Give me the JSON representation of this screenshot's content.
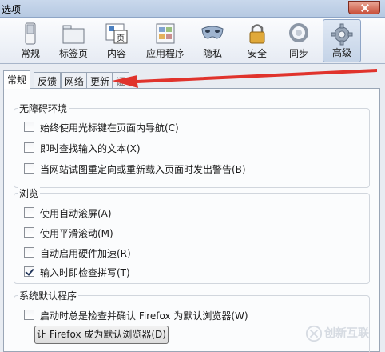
{
  "window": {
    "title": "选项"
  },
  "toolbar": {
    "panes": [
      {
        "label": "常规",
        "icon": "switch-icon"
      },
      {
        "label": "标签页",
        "icon": "folder-tabs-icon"
      },
      {
        "label": "内容",
        "icon": "page-content-icon"
      },
      {
        "label": "应用程序",
        "icon": "applications-icon"
      },
      {
        "label": "隐私",
        "icon": "mask-icon"
      },
      {
        "label": "安全",
        "icon": "padlock-icon"
      },
      {
        "label": "同步",
        "icon": "sync-icon"
      },
      {
        "label": "高级",
        "icon": "gear-icon"
      }
    ],
    "selected": "高级"
  },
  "subtabs": [
    {
      "label": "常规",
      "active": true
    },
    {
      "label": "反馈",
      "active": false
    },
    {
      "label": "网络",
      "active": false
    },
    {
      "label": "更新",
      "active": false
    },
    {
      "label": "证",
      "active": false
    }
  ],
  "groups": {
    "accessibility": {
      "title": "无障碍环境",
      "options": [
        {
          "label": "始终使用光标键在页面内导航(C)",
          "checked": false
        },
        {
          "label": "即时查找输入的文本(X)",
          "checked": false
        },
        {
          "label": "当网站试图重定向或重新载入页面时发出警告(B)",
          "checked": false
        }
      ]
    },
    "browsing": {
      "title": "浏览",
      "options": [
        {
          "label": "使用自动滚屏(A)",
          "checked": false
        },
        {
          "label": "使用平滑滚动(M)",
          "checked": false
        },
        {
          "label": "自动启用硬件加速(R)",
          "checked": false
        },
        {
          "label": "输入时即检查拼写(T)",
          "checked": true
        }
      ]
    },
    "system_defaults": {
      "title": "系统默认程序",
      "options": [
        {
          "label": "启动时总是检查并确认 Firefox 为默认浏览器(W)",
          "checked": false
        }
      ],
      "button_label": "让 Firefox 成为默认浏览器(D)"
    }
  },
  "annotation": {
    "arrow_color": "#e0332c"
  },
  "watermark": {
    "text": "创新互联"
  }
}
